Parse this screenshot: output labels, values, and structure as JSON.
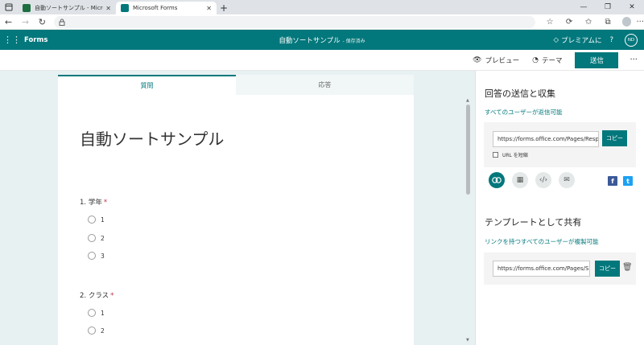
{
  "browser": {
    "tabs": [
      {
        "title": "自動ソートサンプル - Microsoft Excel",
        "favicon_color": "#1d6f42",
        "active": false
      },
      {
        "title": "Microsoft Forms",
        "favicon_color": "#03787c",
        "active": true
      }
    ],
    "new_tab_label": "+",
    "icons": [
      "tab-actions-icon",
      "back-icon",
      "forward-icon",
      "refresh-icon",
      "lock-icon",
      "favorites-icon",
      "extensions-icon",
      "collections-icon",
      "profile-icon",
      "more-icon"
    ]
  },
  "header": {
    "app_name": "Forms",
    "doc_title": "自動ソートサンプル",
    "saved_status": "- 保存済み",
    "premium_label": "プレミアムに",
    "help_label": "?",
    "user_initials": "ND",
    "accent": "#03787c"
  },
  "commandbar": {
    "preview_label": "プレビュー",
    "theme_label": "テーマ",
    "send_label": "送信",
    "more_label": "···"
  },
  "form": {
    "tabs": [
      {
        "label": "質問"
      },
      {
        "label": "応答"
      }
    ],
    "title": "自動ソートサンプル",
    "questions": [
      {
        "number": "1.",
        "text": "学年",
        "required_mark": "*",
        "options": [
          "1",
          "2",
          "3"
        ]
      },
      {
        "number": "2.",
        "text": "クラス",
        "required_mark": "*",
        "options": [
          "1",
          "2"
        ]
      }
    ]
  },
  "panel": {
    "collect_heading": "回答の送信と収集",
    "collect_scope": "すべてのユーザーが返信可能",
    "collect_url": "https://forms.office.com/Pages/Respon",
    "copy_label": "コピー",
    "shorten_label": "URL を短縮",
    "share_heading": "テンプレートとして共有",
    "share_scope": "リンクを持つすべてのユーザーが複製可能",
    "share_url": "https://forms.office.com/Pages/Shar",
    "share_copy_label": "コピー",
    "facebook_label": "f",
    "twitter_label": "t"
  }
}
